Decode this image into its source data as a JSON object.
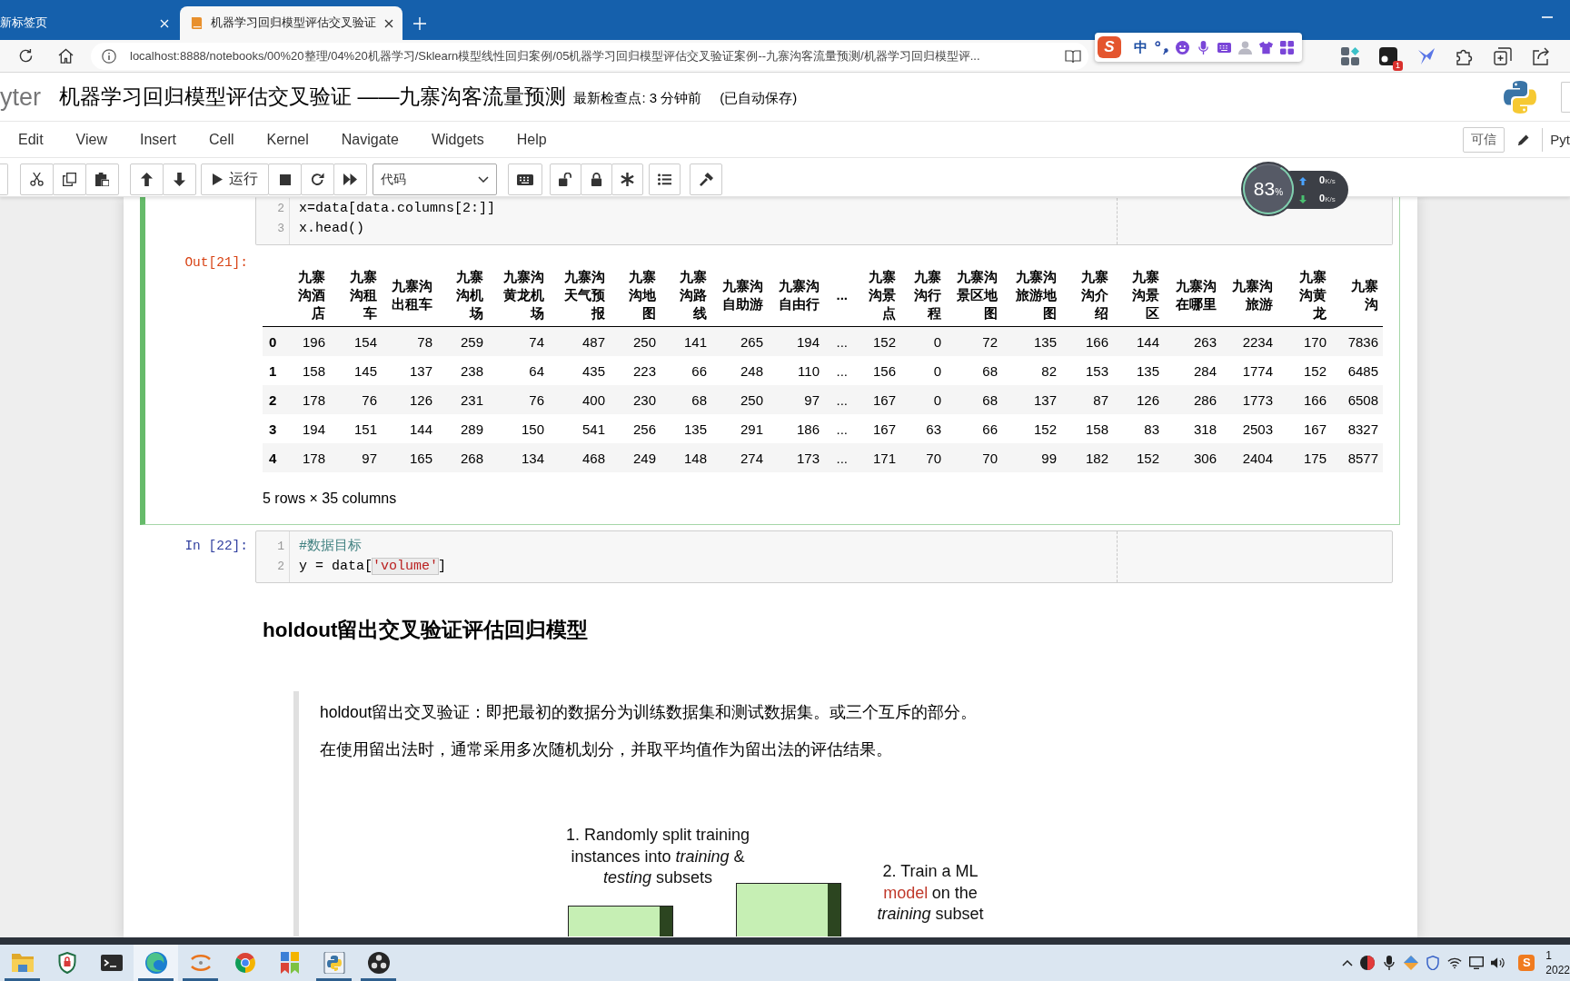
{
  "browser": {
    "tabs": [
      {
        "title": "新标签页",
        "selected": false
      },
      {
        "title": "机器学习回归模型评估交叉验证",
        "selected": true
      }
    ],
    "address": "localhost:8888/notebooks/00%20整理/04%20机器学习/Sklearn模型线性回归案例/05机器学习回归模型评估交叉验证案例--九寨沟客流量预测/机器学习回归模型评...",
    "extension_badge": "1"
  },
  "ime_toolbar": {
    "logo": "S",
    "mode": "中"
  },
  "notebook_header": {
    "logo_text": "yter",
    "title": "机器学习回归模型评估交叉验证 ——九寨沟客流量预测",
    "checkpoint": "最新检查点: 3 分钟前",
    "autosave": "(已自动保存)"
  },
  "menu": {
    "items": [
      "Edit",
      "View",
      "Insert",
      "Cell",
      "Kernel",
      "Navigate",
      "Widgets",
      "Help"
    ],
    "trusted": "可信",
    "kernel": "Pyt"
  },
  "toolbar": {
    "run_label": "运行",
    "cell_type": "代码"
  },
  "net_monitor": {
    "percent": "83",
    "percent_sign": "%",
    "upload": {
      "value": "0",
      "unit": "K/s"
    },
    "download": {
      "value": "0",
      "unit": "K/s"
    }
  },
  "cells": [
    {
      "kind": "code",
      "selected": true,
      "lines": [
        {
          "number": "2",
          "tokens": [
            {
              "text": "x=data[data.columns[2:]]",
              "kind": "plain",
              "highlighted": false
            }
          ]
        },
        {
          "number": "3",
          "tokens": [
            {
              "text": "x.head()",
              "kind": "plain",
              "highlighted": false
            }
          ]
        }
      ],
      "output": {
        "prompt": "Out[21]:",
        "table": {
          "columns": [
            "九寨沟酒店",
            "九寨沟租车",
            "九寨沟出租车",
            "九寨沟机场",
            "九寨沟黄龙机场",
            "九寨沟天气预报",
            "九寨沟地图",
            "九寨沟路线",
            "九寨沟自助游",
            "九寨沟自由行",
            "...",
            "九寨沟景点",
            "九寨沟行程",
            "九寨沟景区地图",
            "九寨沟旅游地图",
            "九寨沟介绍",
            "九寨沟景区",
            "九寨沟在哪里",
            "九寨沟旅游",
            "九寨沟黄龙",
            "九寨沟"
          ],
          "rows": [
            {
              "index": "0",
              "values": [
                "196",
                "154",
                "78",
                "259",
                "74",
                "487",
                "250",
                "141",
                "265",
                "194",
                "...",
                "152",
                "0",
                "72",
                "135",
                "166",
                "144",
                "263",
                "2234",
                "170",
                "7836"
              ]
            },
            {
              "index": "1",
              "values": [
                "158",
                "145",
                "137",
                "238",
                "64",
                "435",
                "223",
                "66",
                "248",
                "110",
                "...",
                "156",
                "0",
                "68",
                "82",
                "153",
                "135",
                "284",
                "1774",
                "152",
                "6485"
              ]
            },
            {
              "index": "2",
              "values": [
                "178",
                "76",
                "126",
                "231",
                "76",
                "400",
                "230",
                "68",
                "250",
                "97",
                "...",
                "167",
                "0",
                "68",
                "137",
                "87",
                "126",
                "286",
                "1773",
                "166",
                "6508"
              ]
            },
            {
              "index": "3",
              "values": [
                "194",
                "151",
                "144",
                "289",
                "150",
                "541",
                "256",
                "135",
                "291",
                "186",
                "...",
                "167",
                "63",
                "66",
                "152",
                "158",
                "83",
                "318",
                "2503",
                "167",
                "8327"
              ]
            },
            {
              "index": "4",
              "values": [
                "178",
                "97",
                "165",
                "268",
                "134",
                "468",
                "249",
                "148",
                "274",
                "173",
                "...",
                "171",
                "70",
                "70",
                "99",
                "182",
                "152",
                "306",
                "2404",
                "175",
                "8577"
              ]
            }
          ]
        },
        "caption": "5 rows × 35 columns"
      }
    },
    {
      "kind": "code",
      "selected": false,
      "prompt": "In [22]:",
      "lines": [
        {
          "number": "1",
          "tokens": [
            {
              "text": "#数据目标",
              "kind": "comment",
              "highlighted": false
            }
          ]
        },
        {
          "number": "2",
          "tokens": [
            {
              "text": "y = data[",
              "kind": "plain",
              "highlighted": false
            },
            {
              "text": "'volume'",
              "kind": "string",
              "highlighted": true
            },
            {
              "text": "]",
              "kind": "plain",
              "highlighted": false
            }
          ]
        }
      ]
    },
    {
      "kind": "markdown",
      "selected": false,
      "heading": "holdout留出交叉验证评估回归模型",
      "quote": [
        "holdout留出交叉验证：即把最初的数据分为训练数据集和测试数据集。或三个互斥的部分。",
        "在使用留出法时，通常采用多次随机划分，并取平均值作为留出法的评估结果。"
      ],
      "figure": {
        "labels": [
          {
            "lines": [
              [
                {
                  "text": "1. Randomly split training",
                  "kind": "plain"
                }
              ],
              [
                {
                  "text": "instances into *training* &",
                  "kind": "plain"
                }
              ],
              [
                {
                  "text": "*testing* subsets",
                  "kind": "plain"
                }
              ]
            ]
          },
          {
            "lines": [
              [
                {
                  "text": "2. Train a ML",
                  "kind": "plain"
                }
              ],
              [
                {
                  "text": "model",
                  "kind": "accent"
                },
                {
                  "text": "on the",
                  "kind": "plain"
                }
              ],
              [
                {
                  "text": "*training* subset",
                  "kind": "plain"
                }
              ]
            ]
          }
        ]
      }
    }
  ],
  "taskbar": {
    "apps": [
      {
        "kind": "folder",
        "running": true,
        "selected": false
      },
      {
        "kind": "shield",
        "running": false,
        "selected": false
      },
      {
        "kind": "terminal",
        "running": false,
        "selected": false
      },
      {
        "kind": "swirl",
        "running": true,
        "selected": true
      },
      {
        "kind": "brackets",
        "running": true,
        "selected": false
      },
      {
        "kind": "wheel",
        "running": false,
        "selected": false
      },
      {
        "kind": "tiles",
        "running": false,
        "selected": false
      },
      {
        "kind": "script",
        "running": true,
        "selected": false
      },
      {
        "kind": "recorder",
        "running": true,
        "selected": false
      }
    ],
    "ime_logo": "S",
    "clock": {
      "time": "1",
      "date": "2022"
    }
  }
}
